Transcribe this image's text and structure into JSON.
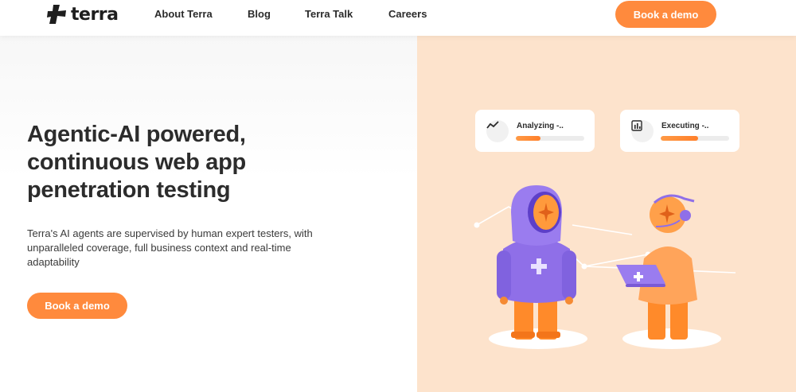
{
  "header": {
    "logo_text": "terra",
    "nav": [
      "About Terra",
      "Blog",
      "Terra Talk",
      "Careers"
    ],
    "cta_label": "Book a demo"
  },
  "hero": {
    "title": "Agentic-AI powered, continuous web app penetration testing",
    "description": "Terra's AI agents are supervised by human expert testers, with unparalleled coverage, full business context and real-time adaptability",
    "cta_label": "Book a demo"
  },
  "status_cards": [
    {
      "label": "Analyzing -..",
      "icon": "trend-line-icon",
      "progress": 0.36
    },
    {
      "label": "Executing -..",
      "icon": "bar-chart-icon",
      "progress": 0.55
    }
  ],
  "colors": {
    "accent": "#ff8a3d",
    "hero_panel": "#fde3cc",
    "hoodie": "#8f6fe8",
    "figure_orange": "#ff8a2a"
  }
}
